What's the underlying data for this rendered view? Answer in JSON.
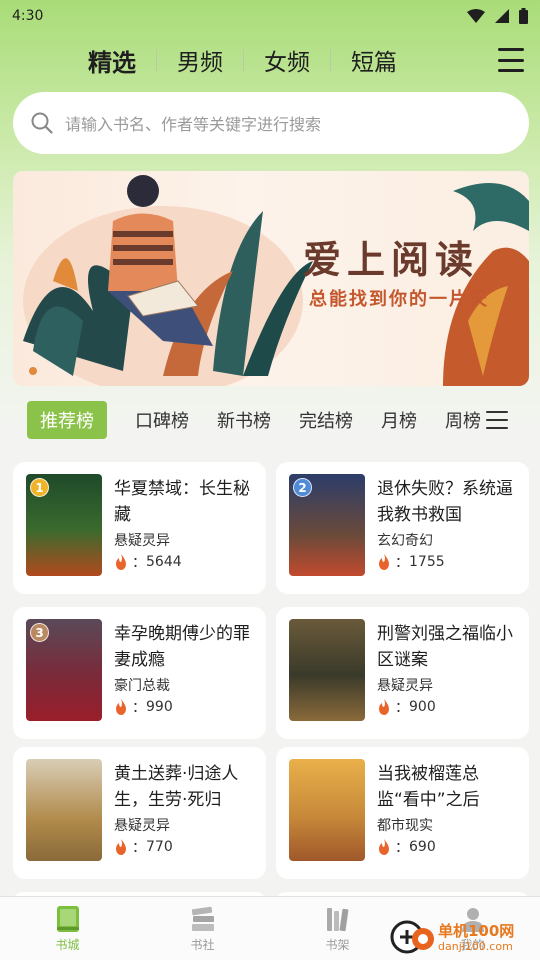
{
  "status_bar": {
    "time": "4:30"
  },
  "channels": [
    {
      "label": "精选",
      "active": true
    },
    {
      "label": "男频",
      "active": false
    },
    {
      "label": "女频",
      "active": false
    },
    {
      "label": "短篇",
      "active": false
    }
  ],
  "search": {
    "placeholder": "请输入书名、作者等关键字进行搜索"
  },
  "banner": {
    "title": "爱上阅读",
    "subtitle": "总能找到你的一片天"
  },
  "rank_tabs": [
    {
      "label": "推荐榜",
      "active": true
    },
    {
      "label": "口碑榜",
      "active": false
    },
    {
      "label": "新书榜",
      "active": false
    },
    {
      "label": "完结榜",
      "active": false
    },
    {
      "label": "月榜",
      "active": false
    },
    {
      "label": "周榜",
      "active": false
    }
  ],
  "books": [
    {
      "rank": "1",
      "title": "华夏禁域：长生秘藏",
      "genre": "悬疑灵异",
      "heat": "5644",
      "heat_prefix": "："
    },
    {
      "rank": "2",
      "title": "退休失败？系统逼我教书救国",
      "genre": "玄幻奇幻",
      "heat": "1755",
      "heat_prefix": "："
    },
    {
      "rank": "3",
      "title": "幸孕晚期傅少的罪妻成瘾",
      "genre": "豪门总裁",
      "heat": "990",
      "heat_prefix": "："
    },
    {
      "rank": "",
      "title": "刑警刘强之福临小区谜案",
      "genre": "悬疑灵异",
      "heat": "900",
      "heat_prefix": "："
    },
    {
      "rank": "",
      "title": "黄土送葬·归途人生，生劳·死归",
      "genre": "悬疑灵异",
      "heat": "770",
      "heat_prefix": "："
    },
    {
      "rank": "",
      "title": "当我被榴莲总监“看中”之后",
      "genre": "都市现实",
      "heat": "690",
      "heat_prefix": "："
    }
  ],
  "bottom_nav": [
    {
      "label": "书城",
      "icon": "book-icon",
      "active": true
    },
    {
      "label": "书社",
      "icon": "books-stack-icon",
      "active": false
    },
    {
      "label": "书架",
      "icon": "bookshelf-icon",
      "active": false
    },
    {
      "label": "我的",
      "icon": "user-icon",
      "active": false
    }
  ],
  "watermark": {
    "main": "单机100网",
    "sub": "danji100.com"
  },
  "colors": {
    "accent": "#8bc34a",
    "badge_gold": "#f0b429",
    "badge_blue": "#4f8bd6",
    "badge_bronze": "#b98a62",
    "flame": "#e8642b"
  }
}
